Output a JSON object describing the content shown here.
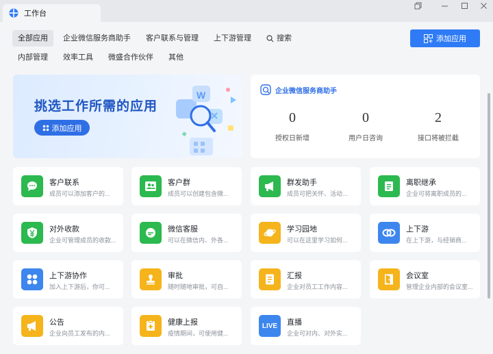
{
  "window": {
    "tab_title": "工作台",
    "controls": [
      "restore-window-icon",
      "minimize-icon",
      "maximize-icon",
      "close-icon"
    ]
  },
  "nav": {
    "row1": [
      "全部应用",
      "企业微信服务商助手",
      "客户联系与管理",
      "上下游管理"
    ],
    "search_label": "搜索",
    "row2": [
      "内部管理",
      "效率工具",
      "微盛合作伙伴",
      "其他"
    ],
    "active": "全部应用"
  },
  "toolbar": {
    "add_app_label": "添加应用"
  },
  "banner": {
    "title": "挑选工作所需的应用",
    "button_label": "添加应用"
  },
  "assistant": {
    "title": "企业微信服务商助手",
    "stats": [
      {
        "value": "0",
        "label": "授权日新增"
      },
      {
        "value": "0",
        "label": "用户日咨询"
      },
      {
        "value": "2",
        "label": "接口将被拦截"
      }
    ]
  },
  "apps": [
    {
      "name": "客户联系",
      "desc": "成员可以添加客户的...",
      "icon": "chat-bubble-icon",
      "color": "#2cb94f"
    },
    {
      "name": "客户群",
      "desc": "成员可以创建包含微...",
      "icon": "group-people-icon",
      "color": "#2cb94f"
    },
    {
      "name": "群发助手",
      "desc": "成员可把关怀、活动...",
      "icon": "megaphone-icon",
      "color": "#2cb94f"
    },
    {
      "name": "离职继承",
      "desc": "企业可将离职成员的...",
      "icon": "document-transfer-icon",
      "color": "#2cb94f"
    },
    {
      "name": "对外收款",
      "desc": "企业可管理成员的收款...",
      "icon": "yuan-shield-icon",
      "color": "#2cb94f"
    },
    {
      "name": "微信客服",
      "desc": "可以在微信内、外各...",
      "icon": "service-chat-icon",
      "color": "#2cb94f"
    },
    {
      "name": "学习园地",
      "desc": "可以在这里学习如何...",
      "icon": "planet-icon",
      "color": "#f5b41b"
    },
    {
      "name": "上下游",
      "desc": "在上下游，与经销商...",
      "icon": "link-icon",
      "color": "#3d86ee"
    },
    {
      "name": "上下游协作",
      "desc": "加入上下游后，你可...",
      "icon": "grid-dots-icon",
      "color": "#3d86ee"
    },
    {
      "name": "审批",
      "desc": "随时随地审批，可自...",
      "icon": "stamp-icon",
      "color": "#f5b41b"
    },
    {
      "name": "汇报",
      "desc": "企业对员工工作内容...",
      "icon": "report-icon",
      "color": "#f5b41b"
    },
    {
      "name": "会议室",
      "desc": "管理企业内部的会议室...",
      "icon": "door-icon",
      "color": "#f5b41b"
    },
    {
      "name": "公告",
      "desc": "企业向员工发布的内...",
      "icon": "announcement-icon",
      "color": "#f5b41b"
    },
    {
      "name": "健康上报",
      "desc": "疫情期间，可使用健...",
      "icon": "health-plus-icon",
      "color": "#f5b41b"
    },
    {
      "name": "直播",
      "desc": "企业可对内、对外实...",
      "icon": "live-icon",
      "color": "#3d86ee",
      "badge": "LIVE"
    }
  ]
}
